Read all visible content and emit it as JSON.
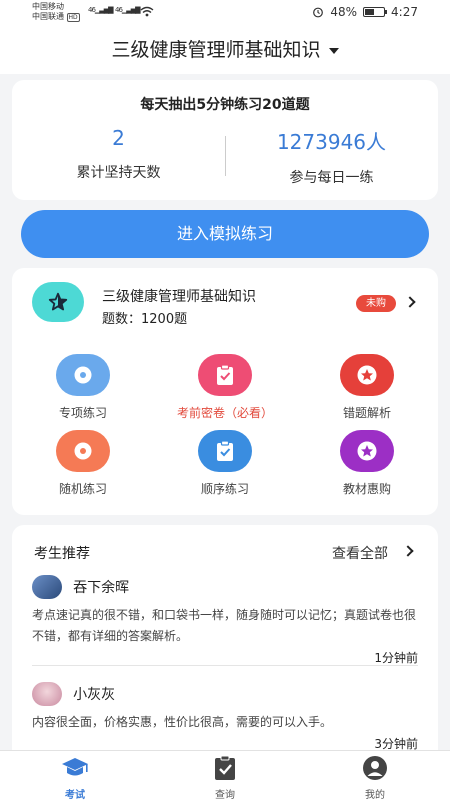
{
  "status_bar": {
    "carrier1": "中国移动",
    "carrier2": "中国联通",
    "hd": "HD",
    "signal1": "46",
    "signal2": "46",
    "battery": "48%",
    "battery_level": 0.48,
    "time": "4:27"
  },
  "header": {
    "title": "三级健康管理师基础知识"
  },
  "stats": {
    "title": "每天抽出5分钟练习20道题",
    "days_value": "2",
    "days_label": "累计坚持天数",
    "participants_value": "1273946人",
    "participants_label": "参与每日一练"
  },
  "cta": {
    "label": "进入模拟练习"
  },
  "subject": {
    "name": "三级健康管理师基础知识",
    "count": "题数：1200题",
    "badge": "未购"
  },
  "grid": [
    {
      "label": "专项练习",
      "color": "#6aa9ec",
      "icon": "disc-icon"
    },
    {
      "label": "考前密卷（必看）",
      "color": "#ee4d74",
      "icon": "clipboard-check-icon"
    },
    {
      "label": "错题解析",
      "color": "#e5403a",
      "icon": "star-icon"
    },
    {
      "label": "随机练习",
      "color": "#f57a55",
      "icon": "disc-icon"
    },
    {
      "label": "顺序练习",
      "color": "#3a8de0",
      "icon": "clipboard-check-icon"
    },
    {
      "label": "教材惠购",
      "color": "#9c2fc5",
      "icon": "star-icon"
    }
  ],
  "recommend": {
    "title": "考生推荐",
    "view_all": "查看全部",
    "reviews": [
      {
        "name": "吞下余晖",
        "text": "考点速记真的很不错，和口袋书一样，随身随时可以记忆；真题试卷也很不错，都有详细的答案解析。",
        "time": "1分钟前"
      },
      {
        "name": "小灰灰",
        "text": "内容很全面，价格实惠，性价比很高，需要的可以入手。",
        "time": "3分钟前"
      }
    ]
  },
  "tabbar": {
    "tabs": [
      {
        "label": "考试",
        "icon": "graduation-cap-icon"
      },
      {
        "label": "查询",
        "icon": "clipboard-check-icon"
      },
      {
        "label": "我的",
        "icon": "user-icon"
      }
    ]
  }
}
